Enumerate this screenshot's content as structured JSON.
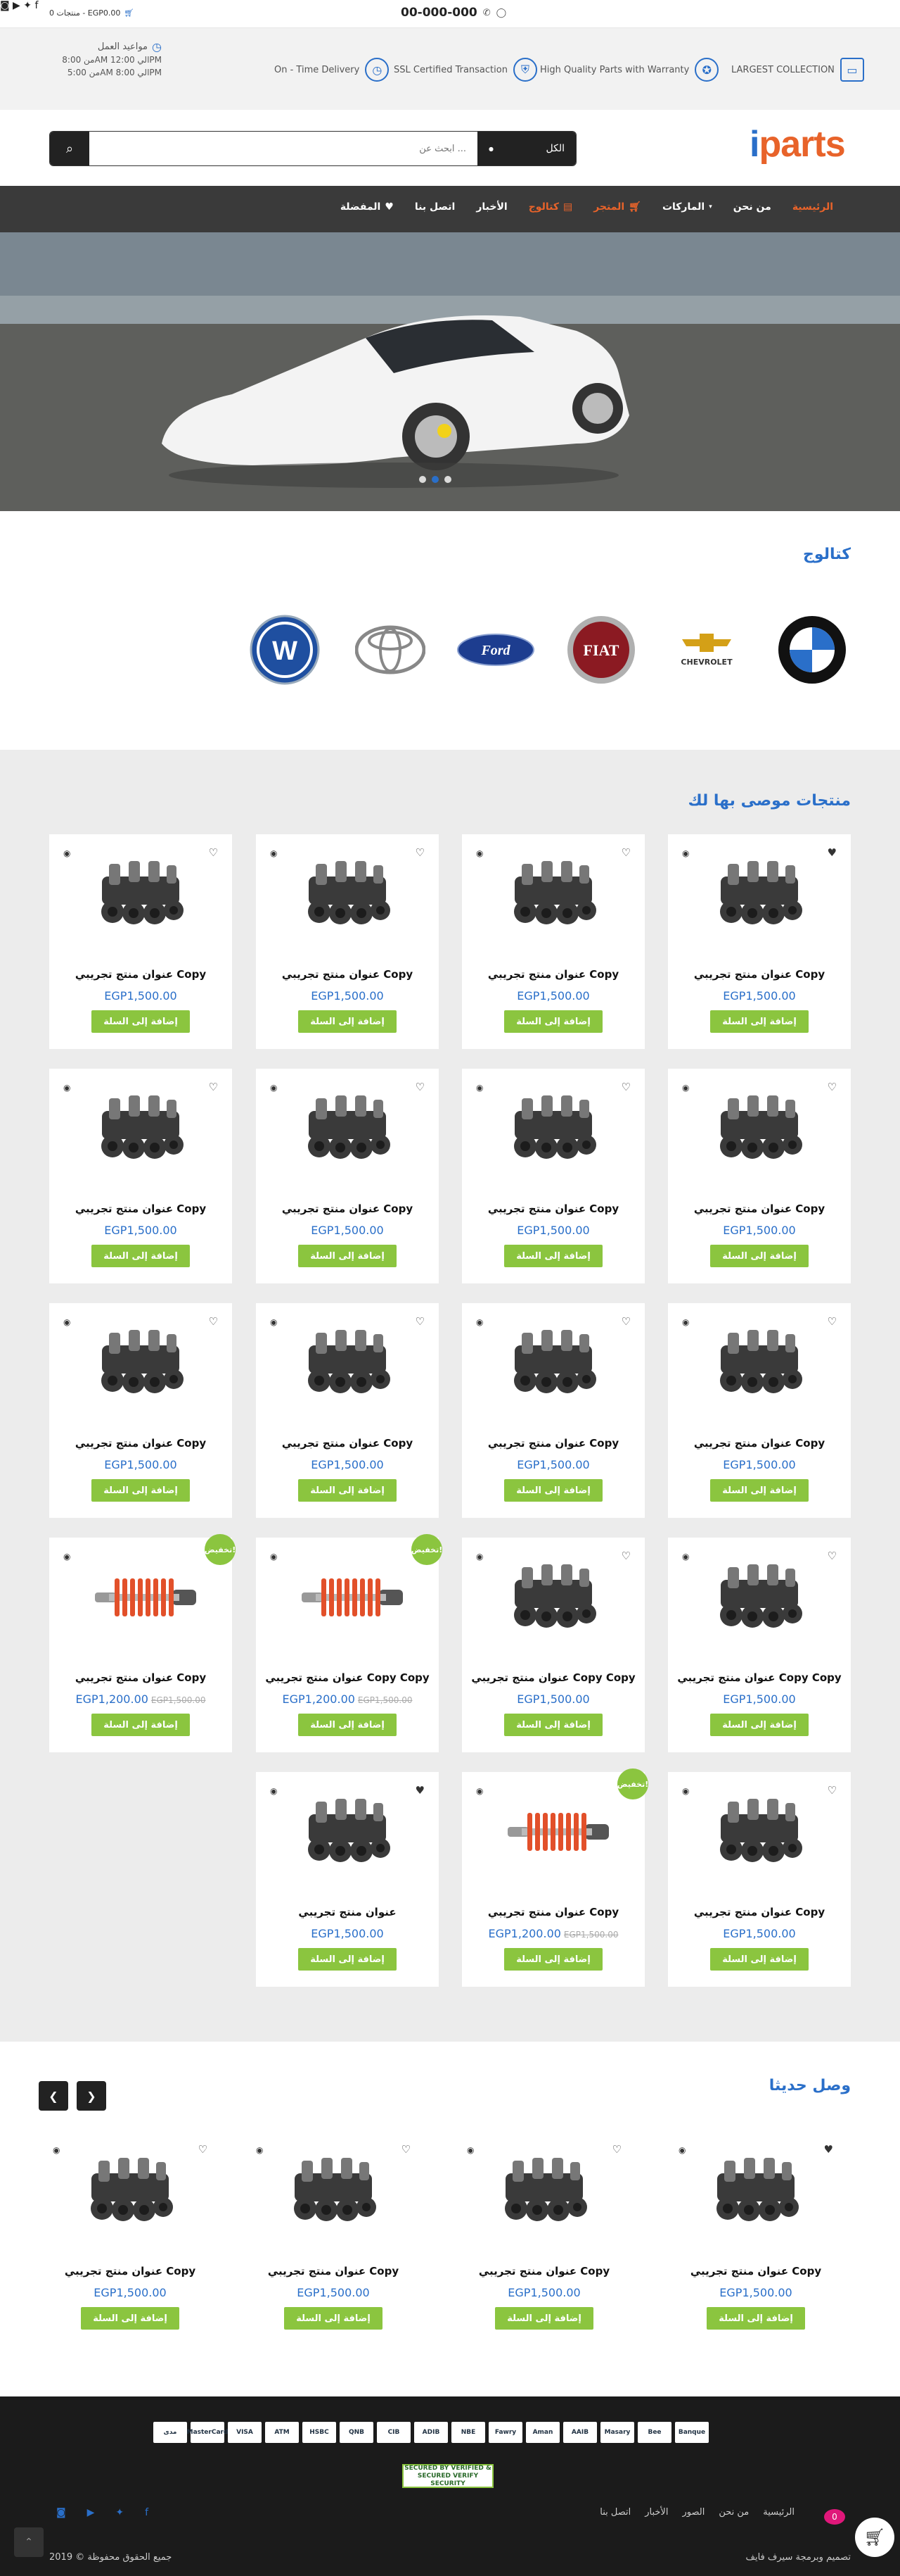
{
  "topbar": {
    "phone": "00-000-000",
    "cart": "0 منتجات - EGP0.00",
    "social": [
      "facebook-icon",
      "twitter-icon",
      "youtube-icon",
      "instagram-icon"
    ]
  },
  "features": [
    {
      "label": "LARGEST COLLECTION",
      "icon": "truck-icon"
    },
    {
      "label": "High Quality Parts with Warranty",
      "icon": "medal-icon"
    },
    {
      "label": "SSL Certified Transaction",
      "icon": "shield-icon"
    },
    {
      "label": "On - Time Delivery",
      "icon": "clock-icon"
    }
  ],
  "hours": {
    "title": "مواعيد العمل",
    "line1": "من 8:00AM الي 12:00PM",
    "line2": "من 5:00AM الي 8:00PM"
  },
  "logo": {
    "first": "i",
    "rest": "parts"
  },
  "search": {
    "placeholder": "ابحث عن ...",
    "category": "الكل"
  },
  "nav": [
    "الرئيسية",
    "من نحن",
    "الماركات",
    "المتجر",
    "كتالوج",
    "الأخبار",
    "اتصل بنا",
    "المفضلة"
  ],
  "catalog": {
    "title": "كتالوج",
    "brands": [
      "BMW",
      "CHEVROLET",
      "FIAT",
      "Ford",
      "TOYOTA",
      "VW"
    ]
  },
  "featured": {
    "title": "منتجات موصى بها لك",
    "add_label": "إضافة إلى السلة",
    "sale_label": "تخفيض!"
  },
  "products": [
    {
      "name": "عنوان منتج تجريبي Copy",
      "price": "EGP1,500.00",
      "old": "",
      "sale": false,
      "type": "engine",
      "fav": true
    },
    {
      "name": "عنوان منتج تجريبي Copy",
      "price": "EGP1,500.00",
      "old": "",
      "sale": false,
      "type": "engine",
      "fav": false
    },
    {
      "name": "عنوان منتج تجريبي Copy",
      "price": "EGP1,500.00",
      "old": "",
      "sale": false,
      "type": "engine",
      "fav": false
    },
    {
      "name": "عنوان منتج تجريبي Copy",
      "price": "EGP1,500.00",
      "old": "",
      "sale": false,
      "type": "engine",
      "fav": false
    },
    {
      "name": "عنوان منتج تجريبي Copy",
      "price": "EGP1,500.00",
      "old": "",
      "sale": false,
      "type": "engine",
      "fav": false
    },
    {
      "name": "عنوان منتج تجريبي Copy",
      "price": "EGP1,500.00",
      "old": "",
      "sale": false,
      "type": "engine",
      "fav": false
    },
    {
      "name": "عنوان منتج تجريبي Copy",
      "price": "EGP1,500.00",
      "old": "",
      "sale": false,
      "type": "engine",
      "fav": false
    },
    {
      "name": "عنوان منتج تجريبي Copy",
      "price": "EGP1,500.00",
      "old": "",
      "sale": false,
      "type": "engine",
      "fav": false
    },
    {
      "name": "عنوان منتج تجريبي Copy",
      "price": "EGP1,500.00",
      "old": "",
      "sale": false,
      "type": "engine",
      "fav": false
    },
    {
      "name": "عنوان منتج تجريبي Copy",
      "price": "EGP1,500.00",
      "old": "",
      "sale": false,
      "type": "engine",
      "fav": false
    },
    {
      "name": "عنوان منتج تجريبي Copy",
      "price": "EGP1,500.00",
      "old": "",
      "sale": false,
      "type": "engine",
      "fav": false
    },
    {
      "name": "عنوان منتج تجريبي Copy",
      "price": "EGP1,500.00",
      "old": "",
      "sale": false,
      "type": "engine",
      "fav": false
    },
    {
      "name": "عنوان منتج تجريبي Copy Copy",
      "price": "EGP1,500.00",
      "old": "",
      "sale": false,
      "type": "engine",
      "fav": false
    },
    {
      "name": "عنوان منتج تجريبي Copy Copy",
      "price": "EGP1,500.00",
      "old": "",
      "sale": false,
      "type": "engine",
      "fav": false
    },
    {
      "name": "عنوان منتج تجريبي Copy Copy",
      "price": "EGP1,200.00",
      "old": "EGP1,500.00",
      "sale": true,
      "type": "shock",
      "fav": false
    },
    {
      "name": "عنوان منتج تجريبي Copy",
      "price": "EGP1,200.00",
      "old": "EGP1,500.00",
      "sale": true,
      "type": "shock",
      "fav": false
    },
    {
      "name": "عنوان منتج تجريبي Copy",
      "price": "EGP1,500.00",
      "old": "",
      "sale": false,
      "type": "engine",
      "fav": false
    },
    {
      "name": "عنوان منتج تجريبي Copy",
      "price": "EGP1,200.00",
      "old": "EGP1,500.00",
      "sale": true,
      "type": "shock",
      "fav": false
    },
    {
      "name": "عنوان منتج تجريبي",
      "price": "EGP1,500.00",
      "old": "",
      "sale": false,
      "type": "engine",
      "fav": true
    }
  ],
  "new_arrivals": {
    "title": "وصل حديثا",
    "items": [
      {
        "name": "عنوان منتج تجريبي Copy",
        "price": "EGP1,500.00",
        "fav": true
      },
      {
        "name": "عنوان منتج تجريبي Copy",
        "price": "EGP1,500.00",
        "fav": false
      },
      {
        "name": "عنوان منتج تجريبي Copy",
        "price": "EGP1,500.00",
        "fav": false
      },
      {
        "name": "عنوان منتج تجريبي Copy",
        "price": "EGP1,500.00",
        "fav": false
      }
    ]
  },
  "footer": {
    "payments": [
      "مدى",
      "MasterCard",
      "VISA",
      "ATM",
      "HSBC",
      "QNB",
      "CIB",
      "ADIB",
      "NBE",
      "Fawry",
      "Aman",
      "AAIB",
      "Masary",
      "Bee",
      "Banque"
    ],
    "ssl": "SECURED BY VERIFIED & SECURED VERIFY SECURITY",
    "links": [
      "الرئيسية",
      "من نحن",
      "الصور",
      "الأخبار",
      "اتصل بنا"
    ],
    "designer": "تصميم وبرمجة سيرف فايف",
    "copyright": "2019 © جميع الحقوق محفوظة",
    "cart_count": "0"
  },
  "colors": {
    "primary": "#2a6fc9",
    "accent": "#e8632a",
    "green": "#8bc53f",
    "dark": "#3a3a3a"
  }
}
